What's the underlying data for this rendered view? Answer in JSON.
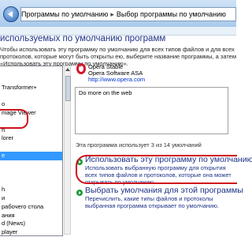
{
  "breadcrumb": {
    "root": "Программы по умолчанию",
    "separator": "▸",
    "current": "Выбор программы по умолчанию"
  },
  "page": {
    "title": "используемых по умолчанию программ",
    "description": "Чтобы использовать эту программу по умолчанию для всех типов файлов и для всех протоколов, которые могут быть открыты ею, выберите название программы, а затем «Использовать эту программу по умолчанию»."
  },
  "programs": {
    "items": [
      {
        "label": "",
        "selected": false
      },
      {
        "label": "",
        "selected": false
      },
      {
        "label": "Transformer+",
        "selected": false
      },
      {
        "label": "",
        "selected": false
      },
      {
        "label": "o",
        "selected": false
      },
      {
        "label": "mage Viewer",
        "selected": false
      },
      {
        "label": "",
        "selected": false
      },
      {
        "label": "h",
        "selected": false
      },
      {
        "label": "lorer",
        "selected": false
      },
      {
        "label": "",
        "selected": false
      },
      {
        "label": "e",
        "selected": true
      },
      {
        "label": "",
        "selected": false
      },
      {
        "label": "",
        "selected": false
      },
      {
        "label": "",
        "selected": false
      },
      {
        "label": "h",
        "selected": false
      },
      {
        "label": "и",
        "selected": false
      },
      {
        "label": "рабочего стола",
        "selected": false
      },
      {
        "label": "ания",
        "selected": false
      },
      {
        "label": "d (News)",
        "selected": false
      },
      {
        "label": "player",
        "selected": false
      }
    ]
  },
  "program": {
    "name": "Opera Stable",
    "publisher": "Opera Software ASA",
    "url": "http://www.opera.com",
    "description": "Do more on the web",
    "defaults_count": "Эта программа использует 3 из 14 умолчаний"
  },
  "options": {
    "set_default_title": "Использовать эту программу по умолчанию",
    "set_default_desc": "Использовать выбранную программу для открытия всех типов файлов и протоколов, которые она может открывать по умолчанию.",
    "choose_defaults_title": "Выбрать умолчания для этой программы",
    "choose_defaults_desc": "Перечислить, какие типы файлов и протоколы выбранная программа открывает по умолчанию."
  },
  "colors": {
    "link_blue": "#1e3287",
    "highlight_ring": "#d0101a",
    "selection": "#3399ff",
    "arrow_green": "#1e9a3a"
  },
  "icons": [
    "back-arrow-icon",
    "opera-logo-icon",
    "green-arrow-icon"
  ]
}
